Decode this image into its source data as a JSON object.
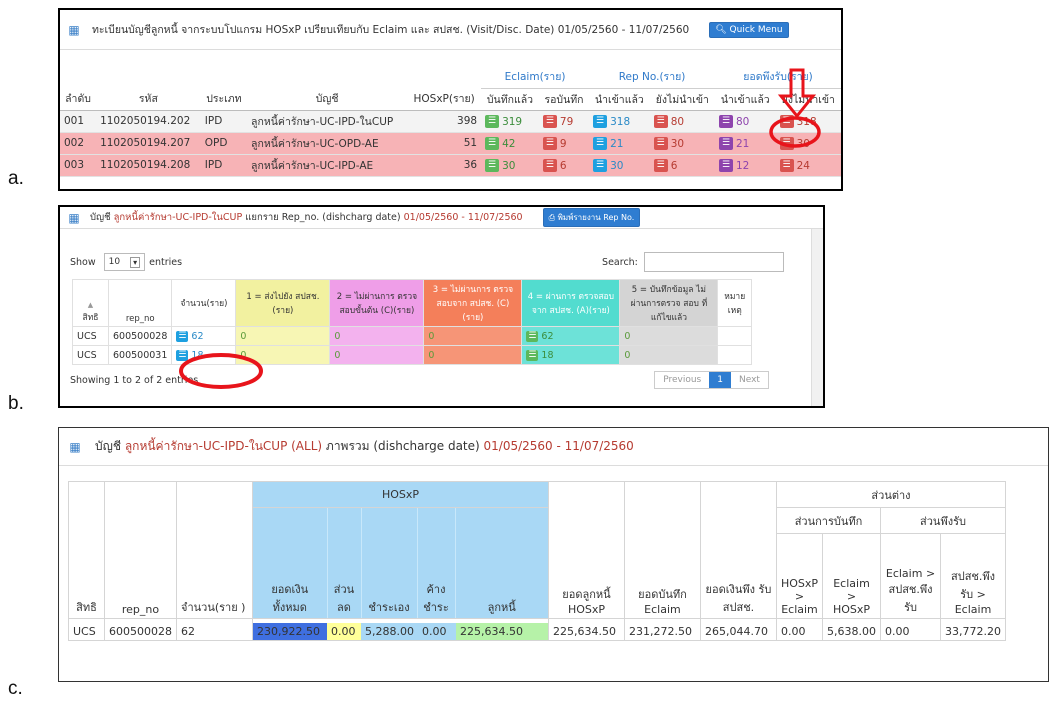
{
  "labels": {
    "a": "a.",
    "b": "b.",
    "c": "c."
  },
  "colors": {
    "accent": "#2f7dd1",
    "title_red": "#b63b31",
    "row_pink": "#f7b3b6",
    "hosxp_blue": "#a9d8f5",
    "annotation_red": "#e8141b",
    "total_blue": "#3f6fe0",
    "discount_yellow": "#ffff99",
    "debt_green": "#b6f2a8"
  },
  "panel_a": {
    "title": "ทะเบียนบัญชีลูกหนี้ จากระบบโปแกรม HOSxP เปรียบเทียบกับ Eclaim และ สปสช. (Visit/Disc. Date) 01/05/2560 - 11/07/2560",
    "quick_menu": "Quick Menu",
    "group_headers": {
      "eclaim": "Eclaim(ราย)",
      "rep": "Rep No.(ราย)",
      "pay": "ยอดพึงรับ(ราย)"
    },
    "columns": [
      "ลำดับ",
      "รหัส",
      "ประเภท",
      "บัญชี",
      "HOSxP(ราย)",
      "บันทึกแล้ว",
      "รอบันทึก",
      "นำเข้าแล้ว",
      "ยังไม่นำเข้า",
      "นำเข้าแล้ว",
      "ยังไม่นำเข้า"
    ],
    "rows": [
      {
        "no": "001",
        "code": "1102050194.202",
        "type": "IPD",
        "account": "ลูกหนี้ค่ารักษา-UC-IPD-ในCUP",
        "hosxp": "398",
        "e1": "319",
        "e2": "79",
        "r1": "318",
        "r2": "80",
        "p1": "80",
        "p2": "318"
      },
      {
        "no": "002",
        "code": "1102050194.207",
        "type": "OPD",
        "account": "ลูกหนี้ค่ารักษา-UC-OPD-AE",
        "hosxp": "51",
        "e1": "42",
        "e2": "9",
        "r1": "21",
        "r2": "30",
        "p1": "21",
        "p2": "30"
      },
      {
        "no": "003",
        "code": "1102050194.208",
        "type": "IPD",
        "account": "ลูกหนี้ค่ารักษา-UC-IPD-AE",
        "hosxp": "36",
        "e1": "30",
        "e2": "6",
        "r1": "30",
        "r2": "6",
        "p1": "12",
        "p2": "24"
      }
    ]
  },
  "panel_b": {
    "title_prefix": "บัญชี",
    "title_account": "ลูกหนี้ค่ารักษา-UC-IPD-ในCUP",
    "title_mid": "แยกราย Rep_no. (dishcharg date)",
    "title_date": "01/05/2560 - 11/07/2560",
    "print_button": "พิมพ์รายงาน Rep No.",
    "show_label": "Show",
    "show_value": "10",
    "entries_label": "entries",
    "search_label": "Search:",
    "columns": [
      "สิทธิ",
      "rep_no",
      "จำนวน(ราย)",
      "1 = ส่งไปยัง สปสช.(ราย)",
      "2 = ไม่ผ่านการ ตรวจสอบขั้นต้น (C)(ราย)",
      "3 = ไม่ผ่านการ ตรวจสอบจาก สปสช. (C)(ราย)",
      "4 = ผ่านการ ตรวจสอบจาก สปสช. (A)(ราย)",
      "5 = บันทึกข้อมูล ไม่ผ่านการตรวจ สอบ ที่แก้ไขแล้ว",
      "หมาย เหตุ"
    ],
    "rows": [
      {
        "right": "UCS",
        "rep": "600500028",
        "count": "62",
        "c1": "0",
        "c2": "0",
        "c3": "0",
        "c4": "62",
        "c5": "0",
        "note": ""
      },
      {
        "right": "UCS",
        "rep": "600500031",
        "count": "18",
        "c1": "0",
        "c2": "0",
        "c3": "0",
        "c4": "18",
        "c5": "0",
        "note": ""
      }
    ],
    "footer": "Showing 1 to 2 of 2 entries",
    "prev": "Previous",
    "page": "1",
    "next": "Next"
  },
  "panel_c": {
    "title_prefix": "บัญชี",
    "title_account": "ลูกหนี้ค่ารักษา-UC-IPD-ในCUP (ALL)",
    "title_mid": "ภาพรวม (dishcharge date)",
    "title_date": "01/05/2560 - 11/07/2560",
    "hosxp": "HOSxP",
    "diff": "ส่วนต่าง",
    "diff_rec": "ส่วนการบันทึก",
    "diff_pay": "ส่วนพึงรับ",
    "columns": [
      "สิทธิ",
      "rep_no",
      "จำนวน(ราย )",
      "ยอดเงิน ทั้งหมด",
      "ส่วน ลด",
      "ชำระเอง",
      "ค้าง ชำระ",
      "ลูกหนี้",
      "ยอดลูกหนี้ HOSxP",
      "ยอดบันทึก Eclaim",
      "ยอดเงินพึง รับ สปสช.",
      "HOSxP > Eclaim",
      "Eclaim > HOSxP",
      "Eclaim > สปสช.พึง รับ",
      "สปสช.พึง รับ > Eclaim"
    ],
    "row": [
      "UCS",
      "600500028",
      "62",
      "230,922.50",
      "0.00",
      "5,288.00",
      "0.00",
      "225,634.50",
      "225,634.50",
      "231,272.50",
      "265,044.70",
      "0.00",
      "5,638.00",
      "0.00",
      "33,772.20"
    ]
  }
}
